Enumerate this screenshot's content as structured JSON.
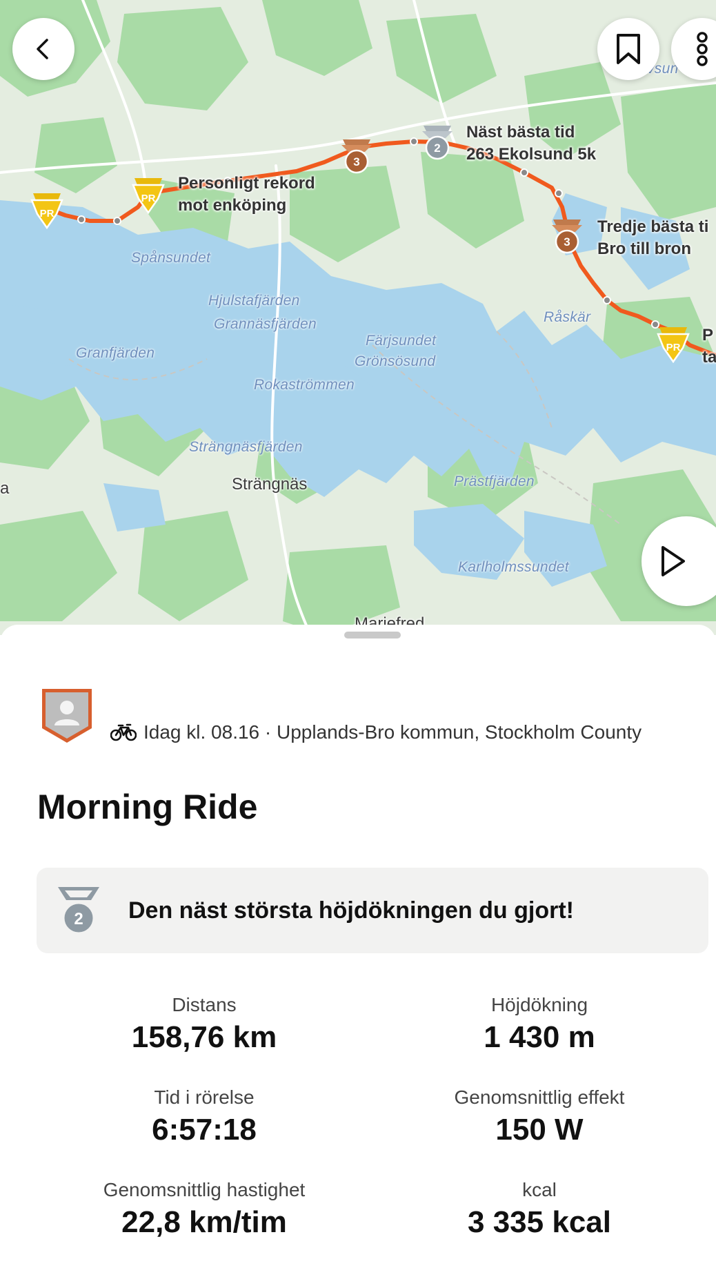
{
  "map": {
    "water_labels": [
      "Spånsundet",
      "Hjulstafjärden",
      "Grannäsfjärden",
      "Granfjärden",
      "Färjsundet",
      "Grönsösund",
      "Rokaströmmen",
      "Strängnäsfjärden",
      "Prästfjärden",
      "Karlholmssundet",
      "Råskär",
      "Mariefred"
    ],
    "town": "Strängnäs",
    "edge_fragments": {
      "left": "a",
      "top_right": "vsun"
    },
    "segments": [
      {
        "medal": "PR",
        "line1": "Personligt rekord",
        "line2": "mot enköping"
      },
      {
        "medal": "2",
        "line1": "Näst bästa tid",
        "line2": "263 Ekolsund 5k"
      },
      {
        "medal": "3",
        "line1": "Tredje bästa ti",
        "line2": "Bro till bron"
      },
      {
        "medal": "PR",
        "line1": "P",
        "line2": "ta"
      }
    ],
    "extra_medals": [
      "PR",
      "3"
    ],
    "colors": {
      "route": "#f05a1e",
      "water": "#a9d3ec",
      "land": "#e4ede0",
      "forest": "#a8d9a5",
      "pr": "#f3c514",
      "silver": "#8e9aa3",
      "bronze": "#b0673c"
    }
  },
  "buttons": {
    "back": "chevron-left-icon",
    "bookmark": "bookmark-icon",
    "more": "more-vertical-icon",
    "play": "play-icon"
  },
  "activity": {
    "meta": "Idag kl. 08.16 · Upplands-Bro kommun, Stockholm County",
    "title": "Morning Ride",
    "achievement": {
      "medal": "2",
      "text": "Den näst största höjdökningen du gjort!"
    },
    "stats": [
      {
        "label": "Distans",
        "value": "158,76 km"
      },
      {
        "label": "Höjdökning",
        "value": "1 430 m"
      },
      {
        "label": "Tid i rörelse",
        "value": "6:57:18"
      },
      {
        "label": "Genomsnittlig effekt",
        "value": "150 W"
      },
      {
        "label": "Genomsnittlig hastighet",
        "value": "22,8 km/tim"
      },
      {
        "label": "kcal",
        "value": "3 335 kcal"
      }
    ]
  }
}
